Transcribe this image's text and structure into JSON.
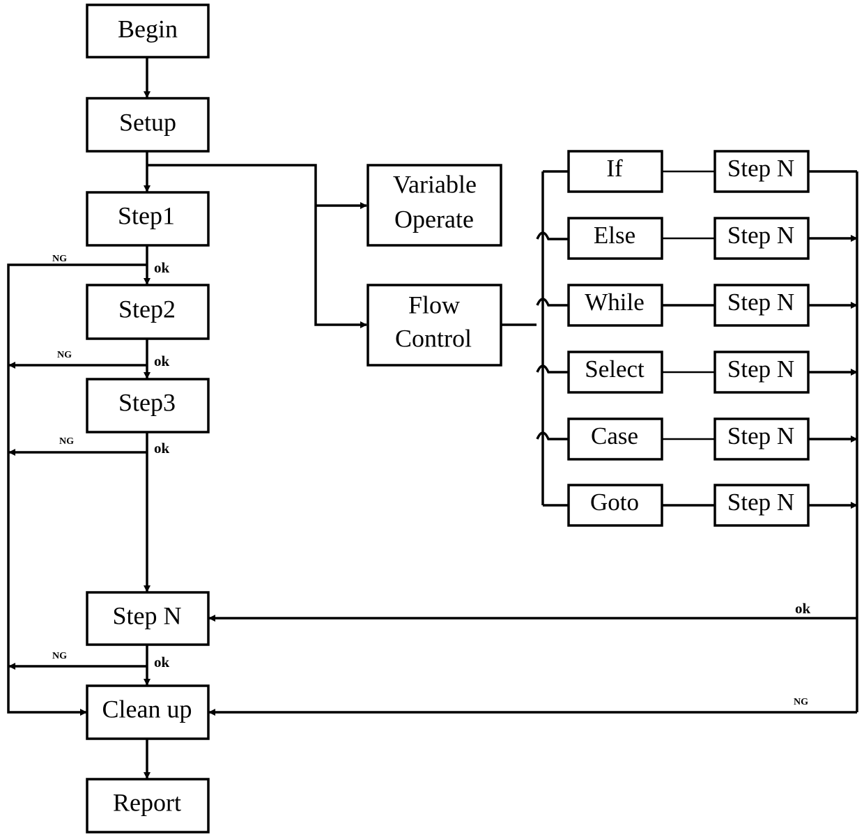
{
  "diagram": {
    "main_flow": {
      "begin": "Begin",
      "setup": "Setup",
      "step1": "Step1",
      "step2": "Step2",
      "step3": "Step3",
      "stepn": "Step N",
      "cleanup": "Clean up",
      "report": "Report"
    },
    "branches": {
      "variable_operate": [
        "Variable",
        "Operate"
      ],
      "flow_control": [
        "Flow",
        "Control"
      ]
    },
    "flow_control_items": [
      {
        "keyword": "If",
        "step": "Step N"
      },
      {
        "keyword": "Else",
        "step": "Step N"
      },
      {
        "keyword": "While",
        "step": "Step N"
      },
      {
        "keyword": "Select",
        "step": "Step N"
      },
      {
        "keyword": "Case",
        "step": "Step N"
      },
      {
        "keyword": "Goto",
        "step": "Step N"
      }
    ],
    "edge_labels": {
      "ok": "ok",
      "ng": "NG"
    }
  }
}
